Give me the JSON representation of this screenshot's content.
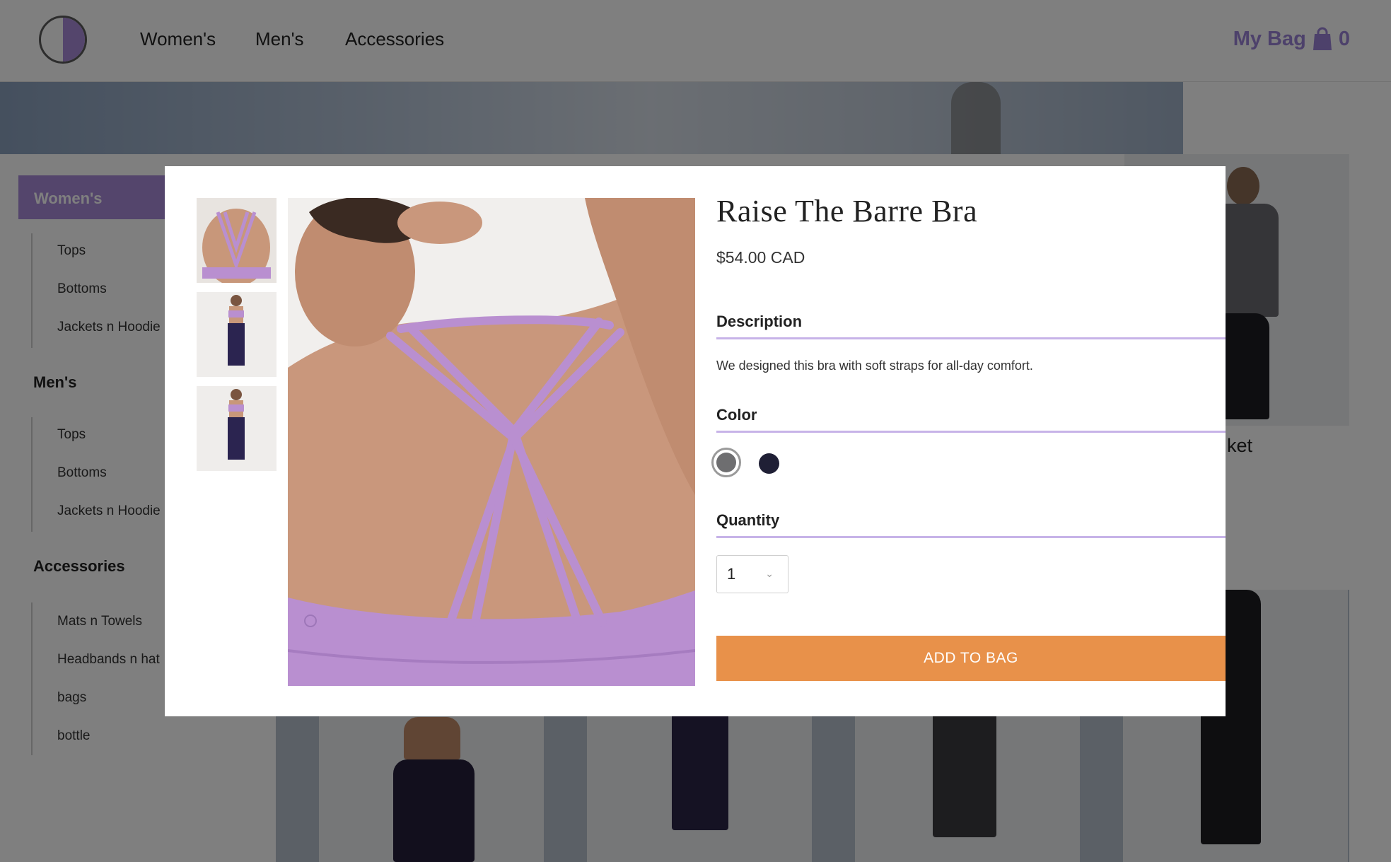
{
  "header": {
    "nav": [
      "Women's",
      "Men's",
      "Accessories"
    ],
    "bag_label": "My Bag",
    "bag_count": "0"
  },
  "sidebar": {
    "active": "Women's",
    "groups": [
      {
        "title": "Women's",
        "items": [
          "Tops",
          "Bottoms",
          "Jackets n Hoodie"
        ]
      },
      {
        "title": "Men's",
        "items": [
          "Tops",
          "Bottoms",
          "Jackets n Hoodie"
        ]
      },
      {
        "title": "Accessories",
        "items": [
          "Mats n Towels",
          "Headbands n hat",
          "bags",
          "bottle"
        ]
      }
    ]
  },
  "background_tiles": {
    "partial_text": "ket"
  },
  "modal": {
    "title": "Raise The Barre Bra",
    "price": "$54.00 CAD",
    "description_label": "Description",
    "description": "We designed this bra with soft straps for all-day comfort.",
    "color_label": "Color",
    "colors": [
      {
        "name": "heathered-grey",
        "hex": "#6e6e70",
        "selected": true
      },
      {
        "name": "navy",
        "hex": "#1f1f35",
        "selected": false
      }
    ],
    "quantity_label": "Quantity",
    "quantity_value": "1",
    "add_button": "ADD TO BAG"
  },
  "colors": {
    "accent": "#a98bd8",
    "rule": "#c7b3e8",
    "cta": "#e8914a",
    "strap": "#b98fd0"
  }
}
